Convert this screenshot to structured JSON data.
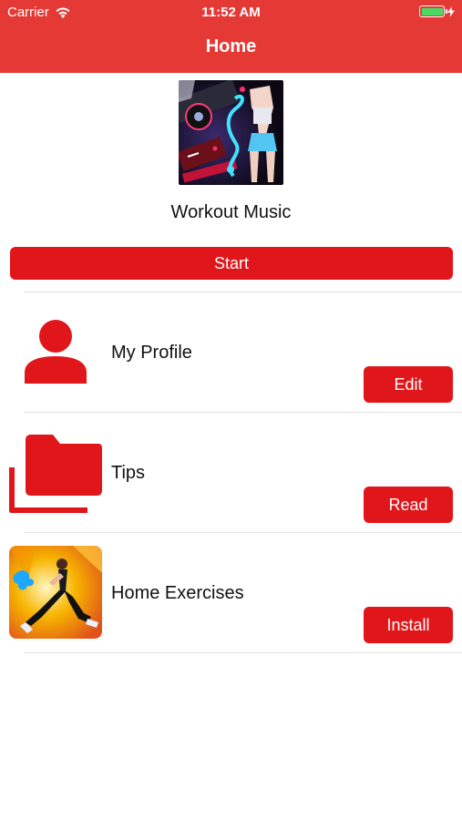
{
  "status_bar": {
    "carrier": "Carrier",
    "time": "11:52 AM",
    "battery_level": 1.0
  },
  "nav": {
    "title": "Home"
  },
  "hero": {
    "image": "workout-music-cover",
    "title": "Workout Music",
    "start_label": "Start"
  },
  "rows": [
    {
      "label": "My Profile",
      "button": "Edit",
      "icon": "person-icon"
    },
    {
      "label": "Tips",
      "button": "Read",
      "icon": "folder-icon"
    },
    {
      "label": "Home Exercises",
      "button": "Install",
      "icon": "exercise-thumbnail"
    }
  ],
  "colors": {
    "header": "#E53935",
    "button": "#E0161B",
    "battery": "#4CD964"
  }
}
